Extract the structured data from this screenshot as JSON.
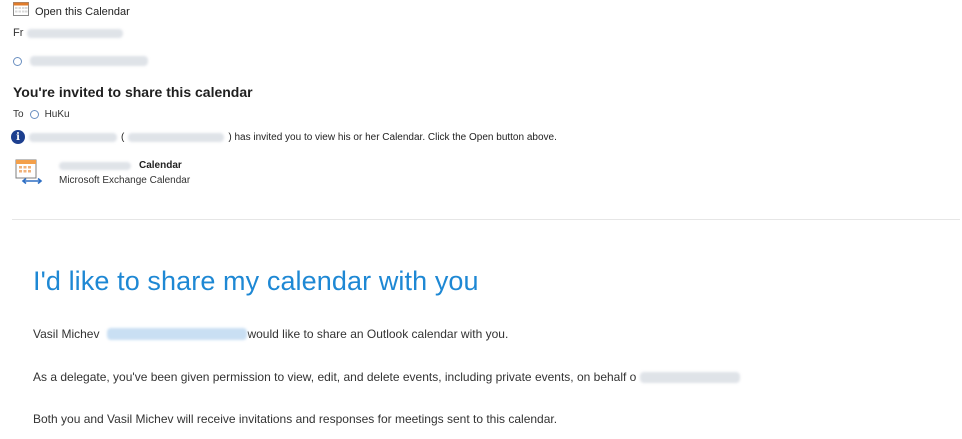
{
  "header": {
    "open_label": "Open this Calendar",
    "from_prefix": "Fr",
    "subject": "You're invited to share this calendar",
    "to_label": "To",
    "to_recipient": "HuKu",
    "info_text": ") has invited you to view his or her Calendar.  Click the Open button above.",
    "info_open_paren": "("
  },
  "attachment": {
    "title": "Calendar",
    "subtitle": "Microsoft Exchange Calendar",
    "icon": "calendar-share-icon"
  },
  "body": {
    "heading": "I'd like to share my calendar with you",
    "p1_name": "Vasil Michev",
    "p1_rest": "would like to share an Outlook calendar with you.",
    "p2": "As a delegate, you've been given permission to view, edit, and delete events, including private events, on behalf o",
    "p3": "Both you and Vasil Michev will receive invitations and responses for meetings sent to this calendar."
  },
  "colors": {
    "heading": "#1e88d4",
    "info_icon": "#1d3f8f"
  }
}
